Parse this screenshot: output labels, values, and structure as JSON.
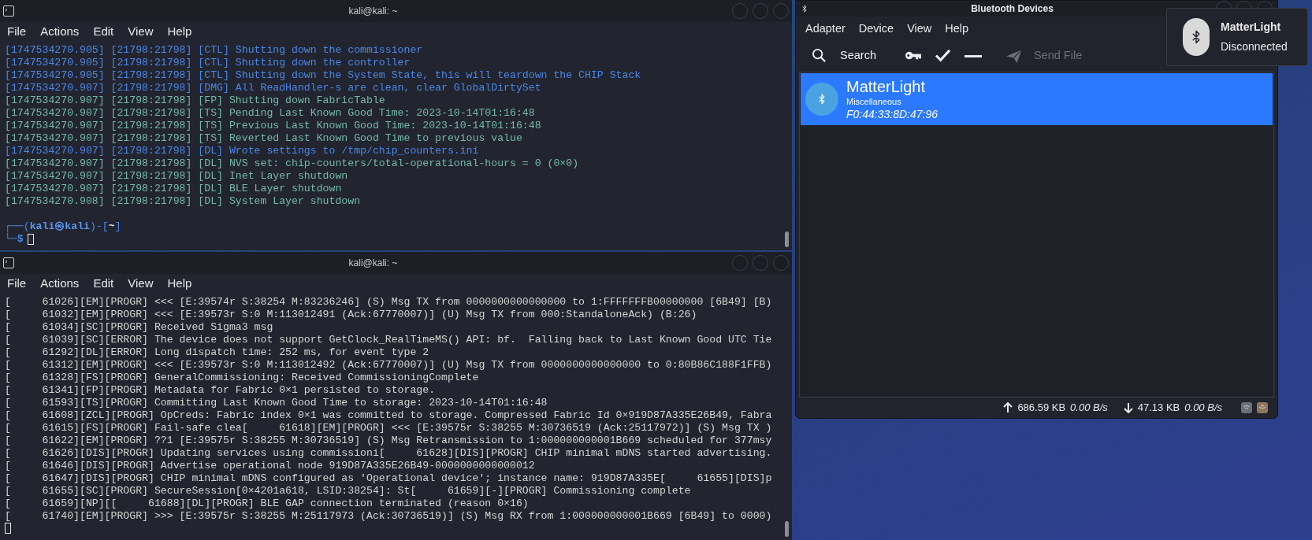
{
  "terminals": [
    {
      "title": "kali@kali: ~",
      "menu": [
        "File",
        "Actions",
        "Edit",
        "View",
        "Help"
      ],
      "lines": [
        {
          "text": "[1747534270.905] [21798:21798] [CTL] Shutting down the commissioner",
          "color": "#4a86e8"
        },
        {
          "text": "[1747534270.905] [21798:21798] [CTL] Shutting down the controller",
          "color": "#4a86e8"
        },
        {
          "text": "[1747534270.905] [21798:21798] [CTL] Shutting down the System State, this will teardown the CHIP Stack",
          "color": "#4a86e8"
        },
        {
          "text": "[1747534270.907] [21798:21798] [DMG] All ReadHandler-s are clean, clear GlobalDirtySet",
          "color": "#4a86e8"
        },
        {
          "text": "[1747534270.907] [21798:21798] [FP] Shutting down FabricTable",
          "color": "#74b9a6"
        },
        {
          "text": "[1747534270.907] [21798:21798] [TS] Pending Last Known Good Time: 2023-10-14T01:16:48",
          "color": "#74b9a6"
        },
        {
          "text": "[1747534270.907] [21798:21798] [TS] Previous Last Known Good Time: 2023-10-14T01:16:48",
          "color": "#74b9a6"
        },
        {
          "text": "[1747534270.907] [21798:21798] [TS] Reverted Last Known Good Time to previous value",
          "color": "#74b9a6"
        },
        {
          "text": "[1747534270.907] [21798:21798] [DL] Wrote settings to /tmp/chip_counters.ini",
          "color": "#4a86e8"
        },
        {
          "text": "[1747534270.907] [21798:21798] [DL] NVS set: chip-counters/total-operational-hours = 0 (0×0)",
          "color": "#74b9a6"
        },
        {
          "text": "[1747534270.907] [21798:21798] [DL] Inet Layer shutdown",
          "color": "#74b9a6"
        },
        {
          "text": "[1747534270.907] [21798:21798] [DL] BLE Layer shutdown",
          "color": "#74b9a6"
        },
        {
          "text": "[1747534270.908] [21798:21798] [DL] System Layer shutdown",
          "color": "#74b9a6"
        }
      ],
      "prompt": {
        "open": "┌──(",
        "user_host": "kali㉿kali",
        "mid": ")-[",
        "dir": "~",
        "close": "]",
        "corner": "└─",
        "symbol": "$"
      }
    },
    {
      "title": "kali@kali: ~",
      "menu": [
        "File",
        "Actions",
        "Edit",
        "View",
        "Help"
      ],
      "lines": [
        {
          "text": "[     61026][EM][PROGR] <<< [E:39574r S:38254 M:83236246] (S) Msg TX from 0000000000000000 to 1:FFFFFFFB00000000 [6B49] [B)",
          "color": "#d4d4d4"
        },
        {
          "text": "[     61032][EM][PROGR] <<< [E:39573r S:0 M:113012491 (Ack:67770007)] (U) Msg TX from 000:StandaloneAck) (B:26)",
          "color": "#d4d4d4"
        },
        {
          "text": "[     61034][SC][PROGR] Received Sigma3 msg",
          "color": "#d4d4d4"
        },
        {
          "text": "[     61039][SC][ERROR] The device does not support GetClock_RealTimeMS() API: bf.  Falling back to Last Known Good UTC Tie",
          "color": "#d4d4d4"
        },
        {
          "text": "[     61292][DL][ERROR] Long dispatch time: 252 ms, for event type 2",
          "color": "#d4d4d4"
        },
        {
          "text": "[     61312][EM][PROGR] <<< [E:39573r S:0 M:113012492 (Ack:67770007)] (U) Msg TX from 0000000000000000 to 0:80B86C188F1FFB)",
          "color": "#d4d4d4"
        },
        {
          "text": "[     61328][FS][PROGR] GeneralCommissioning: Received CommissioningComplete",
          "color": "#d4d4d4"
        },
        {
          "text": "[     61341][FP][PROGR] Metadata for Fabric 0×1 persisted to storage.",
          "color": "#d4d4d4"
        },
        {
          "text": "[     61593][TS][PROGR] Committing Last Known Good Time to storage: 2023-10-14T01:16:48",
          "color": "#d4d4d4"
        },
        {
          "text": "[     61608][ZCL][PROGR] OpCreds: Fabric index 0×1 was committed to storage. Compressed Fabric Id 0×919D87A335E26B49, Fabra",
          "color": "#d4d4d4"
        },
        {
          "text": "[     61615][FS][PROGR] Fail-safe clea[     61618][EM][PROGR] <<< [E:39575r S:38255 M:30736519 (Ack:25117972)] (S) Msg TX )",
          "color": "#d4d4d4"
        },
        {
          "text": "[     61622][EM][PROGR] ??1 [E:39575r S:38255 M:30736519] (S) Msg Retransmission to 1:000000000001B669 scheduled for 377msy",
          "color": "#d4d4d4"
        },
        {
          "text": "[     61626][DIS][PROGR] Updating services using commissioni[     61628][DIS][PROGR] CHIP minimal mDNS started advertising.",
          "color": "#d4d4d4"
        },
        {
          "text": "[     61646][DIS][PROGR] Advertise operational node 919D87A335E26B49-0000000000000012",
          "color": "#d4d4d4"
        },
        {
          "text": "[     61647][DIS][PROGR] CHIP minimal mDNS configured as 'Operational device'; instance name: 919D87A335E[     61655][DIS]p",
          "color": "#d4d4d4"
        },
        {
          "text": "[     61655][SC][PROGR] SecureSession[0×4201a618, LSID:38254]: St[     61659][-][PROGR] Commissioning complete",
          "color": "#d4d4d4"
        },
        {
          "text": "[     61659][NP][[     61688][DL][PROGR] BLE GAP connection terminated (reason 0×16)",
          "color": "#d4d4d4"
        },
        {
          "text": "[     61740][EM][PROGR] >>> [E:39575r S:38255 M:25117973 (Ack:30736519)] (S) Msg RX from 1:000000000001B669 [6B49] to 0000)",
          "color": "#d4d4d4"
        }
      ]
    }
  ],
  "bluetooth": {
    "title": "Bluetooth Devices",
    "menu": [
      "Adapter",
      "Device",
      "View",
      "Help"
    ],
    "toolbar": [
      {
        "kind": "search",
        "label": "Search",
        "disabled": false
      },
      {
        "kind": "key",
        "disabled": false
      },
      {
        "kind": "check",
        "disabled": false
      },
      {
        "kind": "minus",
        "disabled": false
      },
      {
        "kind": "send",
        "label": "Send File",
        "disabled": true
      }
    ],
    "devices": [
      {
        "name": "MatterLight",
        "type": "Miscellaneous",
        "address": "F0:44:33:8D:47:96",
        "selected": true
      }
    ],
    "status": {
      "upload": "686.59 KB",
      "upload_rate": "0.00 B/s",
      "download": "47.13 KB",
      "download_rate": "0.00 B/s"
    }
  },
  "notification": {
    "title": "MatterLight",
    "body": "Disconnected"
  }
}
